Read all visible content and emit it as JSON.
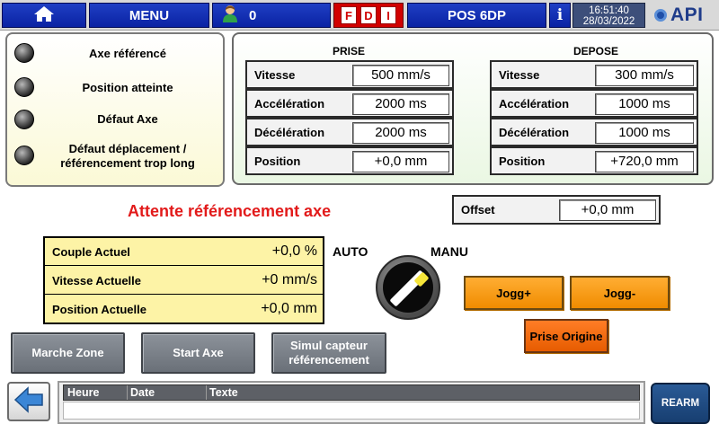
{
  "topbar": {
    "home_icon": "home-icon",
    "menu_label": "MENU",
    "user_icon": "user-icon",
    "user_count": "0",
    "fdi_letters": [
      "F",
      "D",
      "I"
    ],
    "station_label": "POS 6DP",
    "info_label": "i",
    "time": "16:51:40",
    "date": "28/03/2022",
    "logo_text": "API"
  },
  "status": {
    "items": [
      {
        "label": "Axe référencé"
      },
      {
        "label": "Position atteinte"
      },
      {
        "label": "Défaut Axe"
      },
      {
        "label": "Défaut déplacement / référencement trop long"
      }
    ]
  },
  "prise": {
    "title": "PRISE",
    "rows": [
      {
        "label": "Vitesse",
        "value": "500 mm/s"
      },
      {
        "label": "Accélération",
        "value": "2000 ms"
      },
      {
        "label": "Décélération",
        "value": "2000 ms"
      },
      {
        "label": "Position",
        "value": "+0,0 mm"
      }
    ]
  },
  "depose": {
    "title": "DEPOSE",
    "rows": [
      {
        "label": "Vitesse",
        "value": "300 mm/s"
      },
      {
        "label": "Accélération",
        "value": "1000 ms"
      },
      {
        "label": "Décélération",
        "value": "1000 ms"
      },
      {
        "label": "Position",
        "value": "+720,0 mm"
      }
    ]
  },
  "offset": {
    "label": "Offset",
    "value": "+0,0 mm"
  },
  "status_message": "Attente référencement axe",
  "actual": {
    "rows": [
      {
        "label": "Couple Actuel",
        "value": "+0,0 %"
      },
      {
        "label": "Vitesse Actuelle",
        "value": "+0 mm/s"
      },
      {
        "label": "Position Actuelle",
        "value": "+0,0 mm"
      }
    ]
  },
  "mode": {
    "auto_label": "AUTO",
    "manu_label": "MANU",
    "selected": "MANU"
  },
  "jog": {
    "plus_label": "Jogg+",
    "minus_label": "Jogg-",
    "origin_label": "Prise Origine"
  },
  "actions": {
    "marche_zone": "Marche Zone",
    "start_axe": "Start Axe",
    "simul_line1": "Simul capteur",
    "simul_line2": "référencement"
  },
  "alarms": {
    "columns": [
      "Heure",
      "Date",
      "Texte"
    ],
    "rows": []
  },
  "rearm_label": "REARM",
  "colors": {
    "topbar_blue": "#0a22a3",
    "warning_red": "#e21a1a",
    "value_yellow": "#fdf3a6",
    "jog_orange": "#f08c00"
  }
}
